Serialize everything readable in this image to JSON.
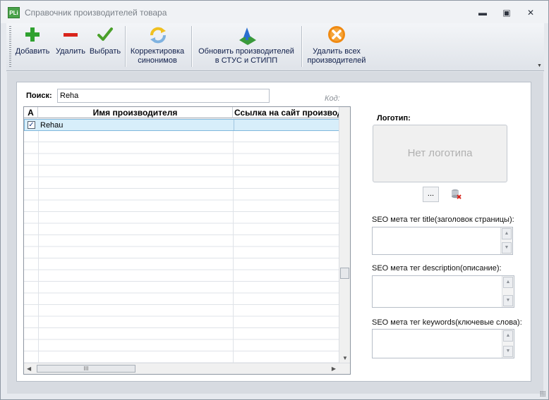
{
  "window": {
    "icon_text": "PLi",
    "title": "Справочник производителей товара",
    "minimize": "▬",
    "maximize": "▣",
    "close": "✕"
  },
  "toolbar": {
    "add": "Добавить",
    "delete": "Удалить",
    "select": "Выбрать",
    "correct_line1": "Корректировка",
    "correct_line2": "синонимов",
    "update_line1": "Обновить производителей",
    "update_line2": "в СТУС и СТИПП",
    "delete_all_line1": "Удалить всех",
    "delete_all_line2": "производителей",
    "colors": {
      "add": "#2fa12f",
      "delete": "#d9241c",
      "select": "#4aa02a",
      "delete_all": "#f08a12"
    }
  },
  "search": {
    "label": "Поиск:",
    "value": "Reha",
    "code_label": "Код:"
  },
  "grid": {
    "columns": [
      "А",
      "Имя производителя",
      "Ссылка на сайт производителя"
    ],
    "rows": [
      {
        "checked": "✓",
        "name": "Rehau",
        "url": ""
      }
    ],
    "hscroll_grip": "III"
  },
  "logo": {
    "label": "Логотип:",
    "placeholder": "Нет логотипа",
    "browse_label": "..."
  },
  "seo": {
    "title_label": "SEO мета тег title(заголовок страницы):",
    "description_label": "SEO мета тег description(описание):",
    "keywords_label": "SEO мета тег keywords(ключевые слова):",
    "title_value": "",
    "description_value": "",
    "keywords_value": ""
  }
}
